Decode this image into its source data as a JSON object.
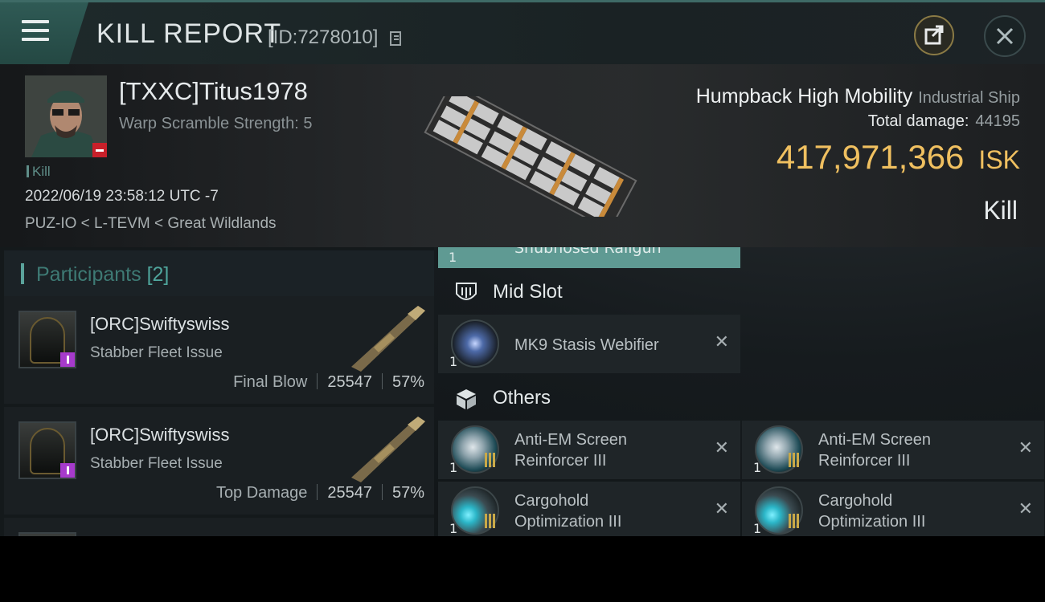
{
  "header": {
    "title": "KILL REPORT",
    "id_label": "[ID:7278010]"
  },
  "victim": {
    "name": "[TXXC]Titus1978",
    "warp_scramble": "Warp Scramble Strength: 5",
    "kill_tag": "Kill",
    "datetime": "2022/06/19 23:58:12 UTC -7",
    "location": "PUZ-IO < L-TEVM < Great Wildlands",
    "ship_name": "Humpback High Mobility",
    "ship_class": "Industrial Ship",
    "total_damage_label": "Total damage:",
    "total_damage": "44195",
    "isk_value": "417,971,366",
    "isk_unit": "ISK",
    "result": "Kill"
  },
  "participants": {
    "label": "Participants",
    "count": "[2]",
    "rows": [
      {
        "name": "[ORC]Swiftyswiss",
        "ship": "Stabber Fleet Issue",
        "role": "Final Blow",
        "damage": "25547",
        "percent": "57%"
      },
      {
        "name": "[ORC]Swiftyswiss",
        "ship": "Stabber Fleet Issue",
        "role": "Top Damage",
        "damage": "25547",
        "percent": "57%"
      }
    ]
  },
  "modules": {
    "high_partial": {
      "qty": "1",
      "name": "Snubnosed Railgun"
    },
    "mid_slot": {
      "label": "Mid Slot",
      "items": [
        {
          "qty": "1",
          "name": "MK9 Stasis Webifier",
          "close": "✕"
        }
      ]
    },
    "others": {
      "label": "Others",
      "items": [
        {
          "qty": "1",
          "line1": "Anti-EM Screen",
          "line2": "Reinforcer III",
          "close": "✕"
        },
        {
          "qty": "1",
          "line1": "Anti-EM Screen",
          "line2": "Reinforcer III",
          "close": "✕"
        },
        {
          "qty": "1",
          "line1": "Cargohold",
          "line2": "Optimization III",
          "close": "✕"
        },
        {
          "qty": "1",
          "line1": "Cargohold",
          "line2": "Optimization III",
          "close": "✕"
        }
      ]
    }
  },
  "colors": {
    "accent": "#5f9a93",
    "isk": "#f0c060",
    "danger": "#c8202a",
    "corp_badge": "#a63acb"
  }
}
